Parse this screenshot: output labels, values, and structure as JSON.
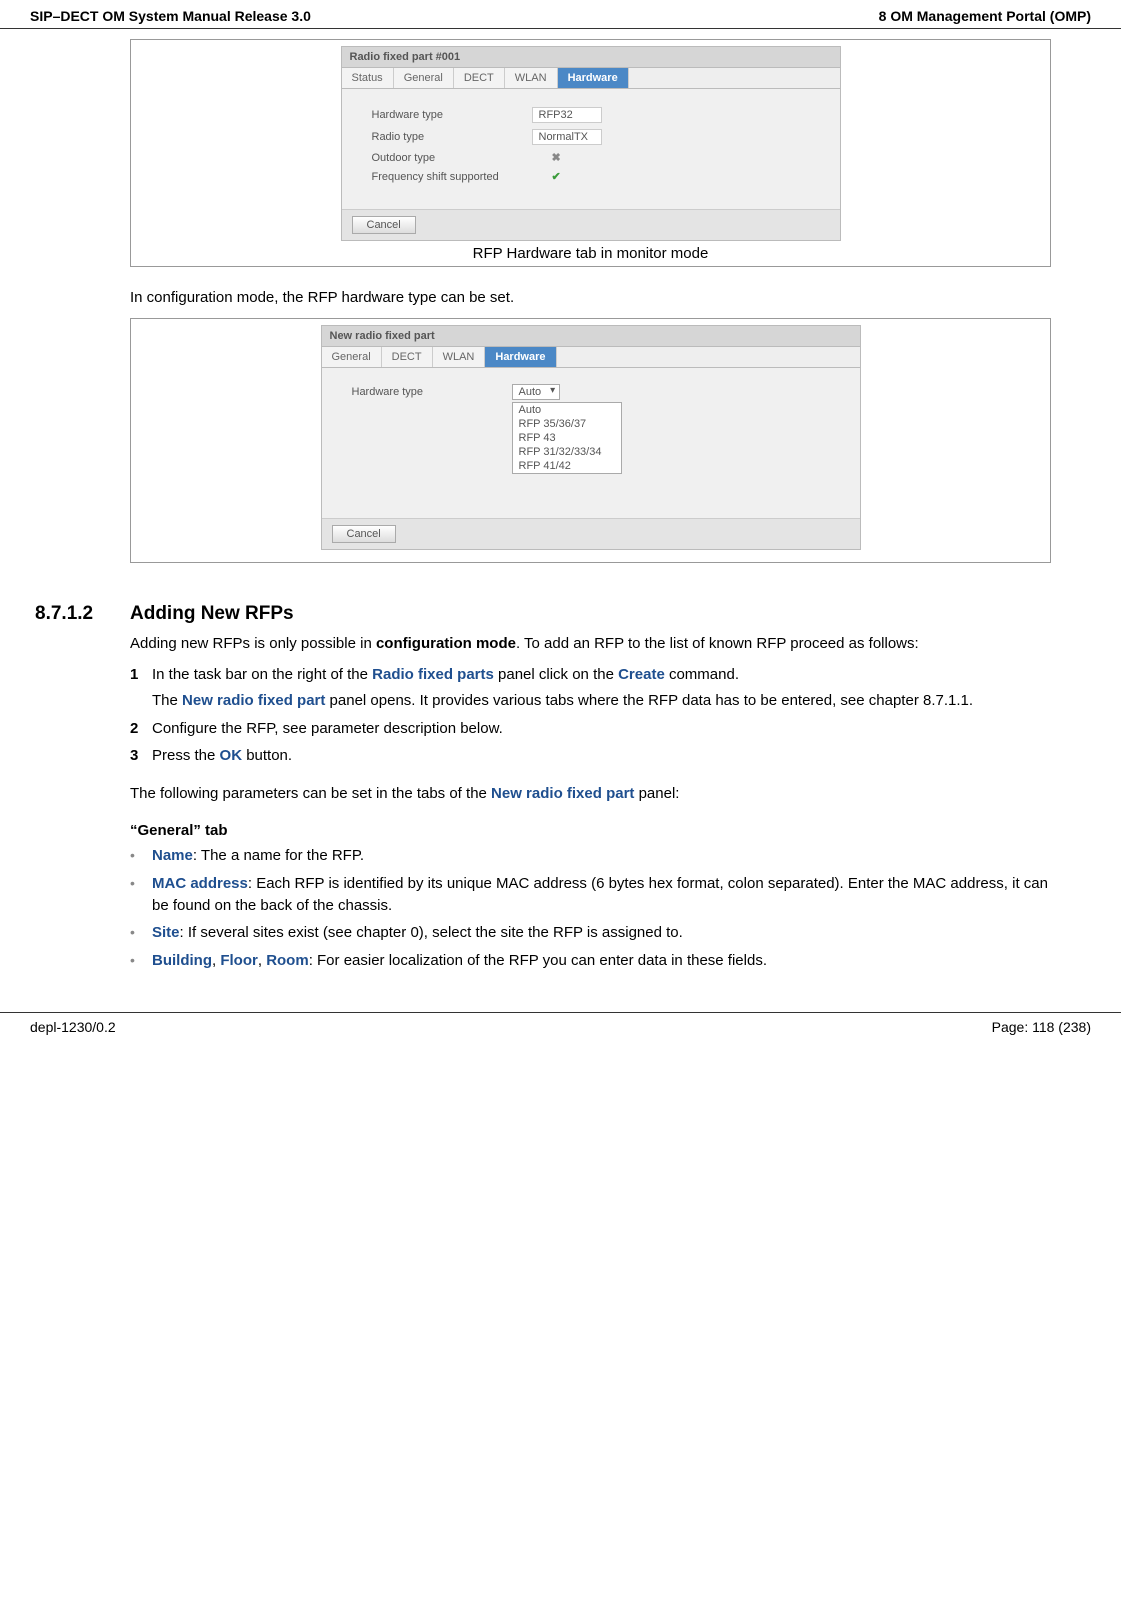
{
  "header": {
    "left": "SIP–DECT OM System Manual Release 3.0",
    "right": "8 OM Management Portal (OMP)"
  },
  "figure1": {
    "caption": "RFP Hardware tab in monitor mode",
    "panel_title": "Radio fixed part #001",
    "tabs": [
      "Status",
      "General",
      "DECT",
      "WLAN",
      "Hardware"
    ],
    "active_tab": "Hardware",
    "rows": {
      "hw_type_label": "Hardware type",
      "hw_type_value": "RFP32",
      "radio_type_label": "Radio type",
      "radio_type_value": "NormalTX",
      "outdoor_label": "Outdoor type",
      "freq_label": "Frequency shift supported"
    },
    "cancel": "Cancel"
  },
  "intro_text": "In configuration mode, the RFP hardware type can be set.",
  "figure2": {
    "panel_title": "New radio fixed part",
    "tabs": [
      "General",
      "DECT",
      "WLAN",
      "Hardware"
    ],
    "active_tab": "Hardware",
    "hw_type_label": "Hardware type",
    "dropdown_selected": "Auto",
    "dropdown_options": [
      "Auto",
      "RFP 35/36/37",
      "RFP 43",
      "RFP 31/32/33/34",
      "RFP 41/42"
    ],
    "cancel": "Cancel"
  },
  "section": {
    "number": "8.7.1.2",
    "title": "Adding New RFPs",
    "intro_a": "Adding new RFPs is only possible in ",
    "intro_b": "configuration mode",
    "intro_c": ". To add an RFP to the list of known RFP proceed as follows:",
    "step1_a": "In the task bar on the right of the ",
    "step1_b": "Radio fixed parts",
    "step1_c": " panel click on the ",
    "step1_d": "Create",
    "step1_e": " command.",
    "step1_sub_a": "The ",
    "step1_sub_b": "New radio fixed part",
    "step1_sub_c": " panel opens. It provides various tabs where the RFP data has to be entered, see chapter 8.7.1.1.",
    "step2": "Configure the RFP, see parameter description below.",
    "step3_a": "Press the ",
    "step3_b": "OK",
    "step3_c": " button.",
    "after_a": "The following parameters can be set in the tabs of the ",
    "after_b": "New radio fixed part",
    "after_c": " panel:"
  },
  "general_tab": {
    "heading": "“General” tab",
    "b1_a": "Name",
    "b1_b": ": The a name for the RFP.",
    "b2_a": "MAC address",
    "b2_b": ": Each RFP is identified by its unique MAC address (6 bytes hex format, colon separated). Enter the MAC address, it can be found on the back of the chassis.",
    "b3_a": "Site",
    "b3_b": ": If several sites exist (see chapter 0), select the site the RFP is assigned to.",
    "b4_a": "Building",
    "b4_sep1": ", ",
    "b4_b": "Floor",
    "b4_sep2": ", ",
    "b4_c": "Room",
    "b4_d": ": For easier localization of the RFP you can enter data in these fields."
  },
  "footer": {
    "left": "depl-1230/0.2",
    "right": "Page: 118 (238)"
  }
}
